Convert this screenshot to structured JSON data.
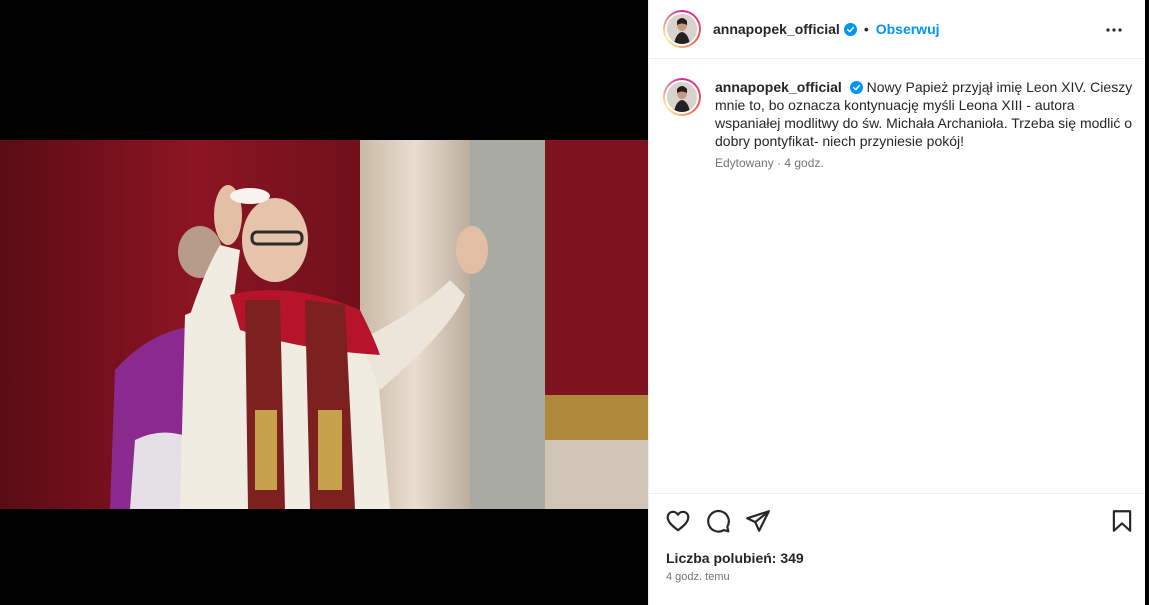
{
  "post": {
    "username": "annapopek_official",
    "follow_label": "Obserwuj",
    "separator": "•",
    "caption": {
      "username": "annapopek_official",
      "text": "Nowy Papież przyjął imię Leon XIV. Cieszy mnie to, bo oznacza kontynuację myśli Leona XIII - autora wspaniałej modlitwy do św. Michała Archanioła. Trzeba się modlić o dobry pontyfikat- niech przyniesie pokój!",
      "edited": "Edytowany · 4 godz."
    },
    "likes": "Liczba polubień: 349",
    "timestamp": "4 godz. temu"
  },
  "icons": {
    "verified": "verified-badge-icon",
    "more": "more-options-icon",
    "like": "heart-icon",
    "comment": "comment-icon",
    "share": "paper-plane-icon",
    "save": "bookmark-icon"
  },
  "colors": {
    "accent": "#0095f6",
    "text": "#262626",
    "muted": "#737373",
    "border": "#efefef"
  }
}
